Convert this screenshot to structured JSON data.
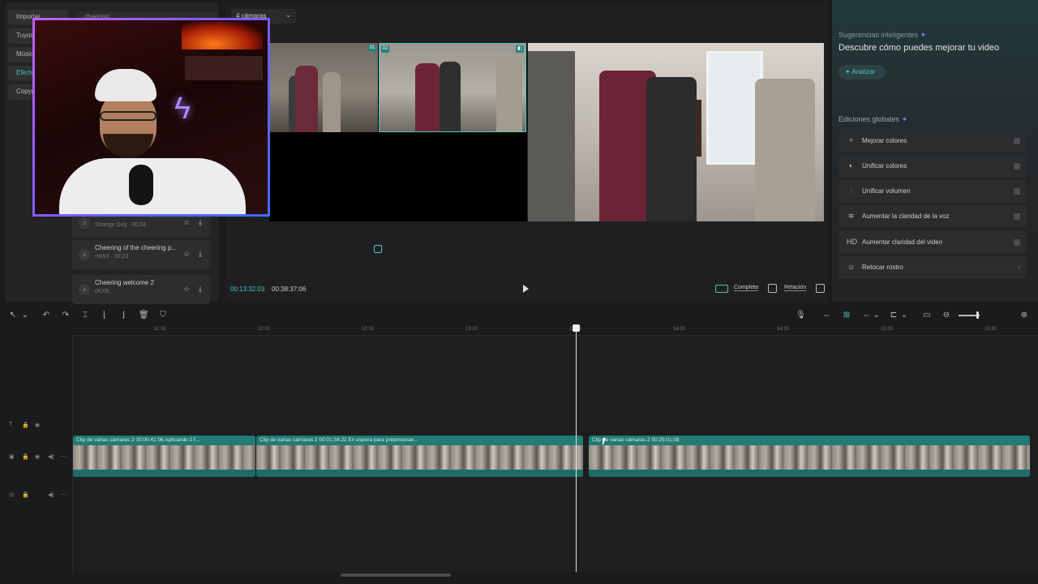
{
  "library": {
    "nav": [
      "Importar",
      "Tuyos",
      "Música",
      "Efectos",
      "Copyright"
    ],
    "search": "cheering",
    "sounds": [
      {
        "title": "",
        "meta": "Strange Dog · 00:04"
      },
      {
        "title": "Cheering of the cheering p...",
        "meta": "rnk93 · 00:23"
      },
      {
        "title": "Cheering welcome 2",
        "meta": "00:06"
      }
    ]
  },
  "preview": {
    "camera_select": "4 cámaras",
    "tile_tags": [
      "01",
      "02"
    ],
    "current_time": "00:13:32:03",
    "total_time": "00:38:37:06",
    "full_label": "Completa",
    "ratio_label": "Relación"
  },
  "right_panel": {
    "suggestions_title": "Sugerencias inteligentes",
    "suggestions_subtitle": "Descubre cómo puedes mejorar tu video",
    "analyze_label": "Analizar",
    "global_edits_title": "Ediciones globales",
    "items": [
      {
        "label": "Mejorar colores",
        "icon": "magic-wand-icon"
      },
      {
        "label": "Unificar colores",
        "icon": "palette-icon"
      },
      {
        "label": "Unificar volumen",
        "icon": "sliders-icon"
      },
      {
        "label": "Aumentar la claridad de la voz",
        "icon": "voice-wave-icon"
      },
      {
        "label": "Aumentar claridad del video",
        "icon": "hd-icon"
      },
      {
        "label": "Retocar rostro",
        "icon": "face-retouch-icon"
      }
    ]
  },
  "ruler": [
    "11:30",
    "12:00",
    "12:30",
    "13:00",
    "13:30",
    "14:00",
    "14:30",
    "15:00",
    "15:30"
  ],
  "timeline": {
    "clips": [
      {
        "header": "Clip de varias cámaras 2  00:00:41:06  Aplicando 2 f..."
      },
      {
        "header": "Clip de varias cámaras 2  00:01:34:22  En espera para preprocesar..."
      },
      {
        "header": "Clip de varias cámaras 2  00:25:01:08"
      }
    ]
  },
  "colors": {
    "accent": "#49c6c3",
    "clip": "#247a74",
    "webcam_border": "#7a5cff"
  }
}
